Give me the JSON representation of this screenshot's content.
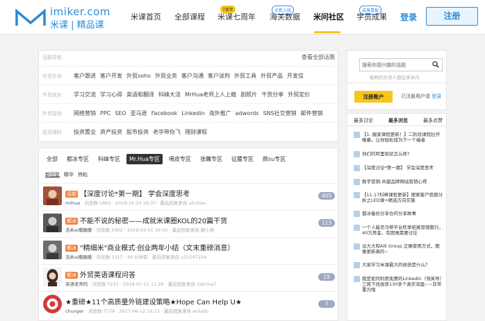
{
  "brand": {
    "en": "imiker.com",
    "cn": "米课 | 精品课"
  },
  "nav": {
    "items": [
      {
        "label": "米课首页"
      },
      {
        "label": "全部课程"
      },
      {
        "label": "米课七周年",
        "badge": "7周年"
      },
      {
        "label": "海关数据",
        "badge": "全新上线"
      },
      {
        "label": "米问社区"
      },
      {
        "label": "学员成果",
        "badge": "成果喜报"
      }
    ],
    "login": "登录",
    "register": "注册"
  },
  "filter": {
    "head": "话题导航",
    "all_link": "查看全部话题",
    "rows": [
      {
        "label": "外贸实务",
        "items": [
          "客户跟进",
          "客户开发",
          "外贸soho",
          "外贸业务",
          "客户沟通",
          "客户谈判",
          "外贸工具",
          "外贸产品",
          "开发信"
        ]
      },
      {
        "label": "外贸成长",
        "items": [
          "学习交流",
          "学习心得",
          "英语和翻译",
          "科峰大法",
          "MrHua老师上人上瘾",
          "剧照片",
          "干货分享",
          "外贸定价"
        ]
      },
      {
        "label": "外贸营销",
        "items": [
          "网络营销",
          "PPC",
          "SEO",
          "亚马逊",
          "Facebook",
          "Linkedin",
          "海外推广",
          "adwords",
          "SNS社交营销",
          "邮件营销"
        ]
      },
      {
        "label": "投资理财",
        "items": [
          "投资置业",
          "资产投资",
          "股市投资",
          "老华带你飞",
          "理财课程"
        ]
      }
    ]
  },
  "list": {
    "tabs": [
      "全部",
      "都冰专区",
      "科峰专区",
      "Mr.Hua专区",
      "嗝皮专区",
      "张瞩专区",
      "征麓专区",
      "颜su专区"
    ],
    "selected_tab": "Mr.Hua专区",
    "subtabs": [
      "新回复",
      "精华",
      "热帖"
    ],
    "posts": [
      {
        "tag": "话题",
        "tag_color": "#f0803c",
        "title": "【深度讨论*第一期】 学会深度思考",
        "meta_user": "mrhua",
        "meta_rest": "· 浏览数:1863 · 2019-10-24 16:37 · 最后回复来自 ahutian",
        "count": "405",
        "avatar_color": "#a0523c"
      },
      {
        "tag": "都冰",
        "tag_color": "#f0803c",
        "title": "不能不说的秘密——成就米课圈KOL的20篇干货",
        "meta_user": "浩米ai撒糖撒",
        "meta_rest": "· 浏览数:5402 · 2019-03-01 16:43 · 最后回复来自 赫小君",
        "count": "113",
        "avatar_color": "#5a5a5a"
      },
      {
        "tag": "都冰",
        "tag_color": "#f0803c",
        "title": "\"精细米\"商业模式·创业两年小结（文末重磅消息）",
        "meta_user": "浩米ai撒糖撒",
        "meta_rest": "· 浏览数:1317 · 49 分钟前 · 最后回复来自 u21547224",
        "count": "",
        "avatar_color": "#6d6d6d"
      },
      {
        "tag": "都冰",
        "tag_color": "#f0803c",
        "title": "外贸英语课程问答",
        "meta_user": "英语老师的",
        "meta_rest": "· 浏览数:7231 · 2019-07-11 11:29 · 最后回复来自 Sabrina7",
        "count": "19",
        "avatar_color": "#3c2a22"
      },
      {
        "tag": "",
        "tag_color": "#f0803c",
        "title": "★重磅★11个高质量外链建设策略★Hope Can Help U★",
        "meta_user": "chunger",
        "meta_rest": "· 浏览数:7178 · 2017-06-12 10:15 · 最后回复来自 wolallo",
        "count": "7",
        "avatar_color": "#d23a3a"
      }
    ]
  },
  "side": {
    "search_placeholder": "搜索你感兴趣的话题",
    "hint": "聪明的外贸人都会来米问",
    "register_btn": "注册账户",
    "already_text": "已注册用户请",
    "already_link": "登录",
    "tabs": [
      "最多讨论",
      "最多浏览",
      "最多点赞"
    ],
    "items": [
      "【1. 搬家课程更新！】二阶段课程拉开帷幕，让你轻松成为下一个编者",
      "你们的阿里现状怎么样？",
      "【深度讨论*第一期】 学会深度思考",
      "数字营销-共建品牌网站营销心得",
      "【11.17科峰课程更新】搜索客户思路分析之LED课+精选方向实施",
      "都冰备份分享仓的分享故事",
      "一个人能否马帮平台旺季拓展营销都行，40万美金，有困难需要讨论",
      "淡大大和Alli Group 正确使用方式，图像更新真的~",
      "大家学习米课最大的收获是什么？",
      "我是如何利用免费的Linkedin（领英导）三周下找收获130多个真实询盘~~非常重万哦"
    ]
  },
  "colors": {
    "brand_blue": "#2b8bd6",
    "accent_yellow": "#f8c51c",
    "count_badge": "#9fa7c1"
  }
}
